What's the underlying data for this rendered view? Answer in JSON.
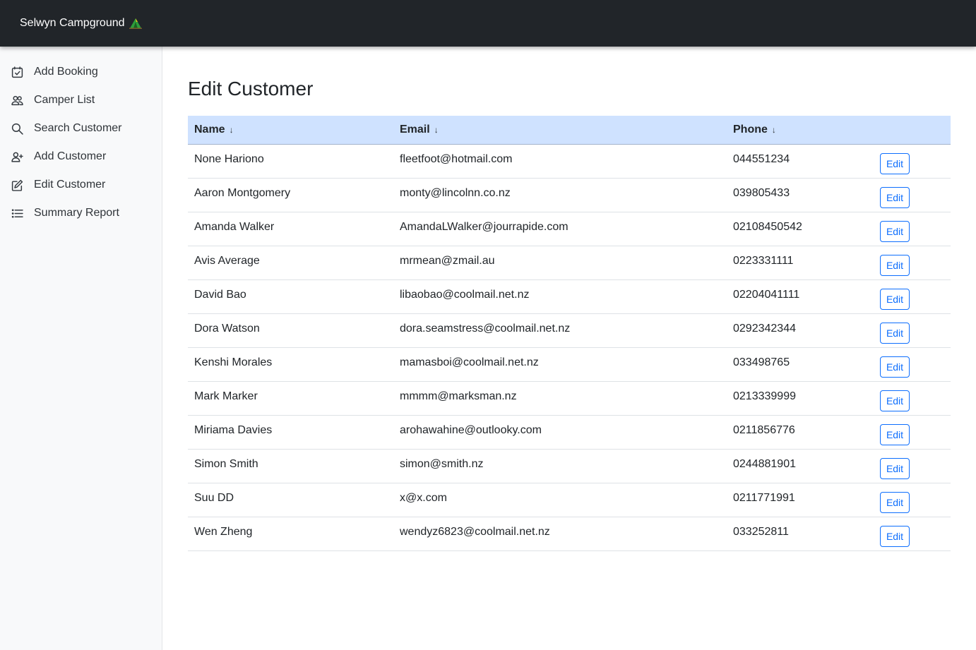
{
  "app": {
    "brand": "Selwyn Campground",
    "brand_icon": "tent-icon"
  },
  "sidebar": {
    "items": [
      {
        "label": "Add Booking",
        "icon": "calendar-check-icon"
      },
      {
        "label": "Camper List",
        "icon": "people-icon"
      },
      {
        "label": "Search Customer",
        "icon": "search-icon"
      },
      {
        "label": "Add Customer",
        "icon": "person-plus-icon"
      },
      {
        "label": "Edit Customer",
        "icon": "pencil-square-icon"
      },
      {
        "label": "Summary Report",
        "icon": "list-icon"
      }
    ]
  },
  "main": {
    "title": "Edit Customer",
    "table": {
      "headers": {
        "name": "Name",
        "email": "Email",
        "phone": "Phone",
        "sort_glyph": "↓"
      },
      "edit_label": "Edit",
      "rows": [
        {
          "name": "None Hariono",
          "email": "fleetfoot@hotmail.com",
          "phone": "044551234"
        },
        {
          "name": "Aaron Montgomery",
          "email": "monty@lincolnn.co.nz",
          "phone": "039805433"
        },
        {
          "name": "Amanda Walker",
          "email": "AmandaLWalker@jourrapide.com",
          "phone": "02108450542"
        },
        {
          "name": "Avis Average",
          "email": "mrmean@zmail.au",
          "phone": "0223331111"
        },
        {
          "name": "David Bao",
          "email": "libaobao@coolmail.net.nz",
          "phone": "02204041111"
        },
        {
          "name": "Dora Watson",
          "email": "dora.seamstress@coolmail.net.nz",
          "phone": "0292342344"
        },
        {
          "name": "Kenshi Morales",
          "email": "mamasboi@coolmail.net.nz",
          "phone": "033498765"
        },
        {
          "name": "Mark Marker",
          "email": "mmmm@marksman.nz",
          "phone": "0213339999"
        },
        {
          "name": "Miriama Davies",
          "email": "arohawahine@outlooky.com",
          "phone": "0211856776"
        },
        {
          "name": "Simon Smith",
          "email": "simon@smith.nz",
          "phone": "0244881901"
        },
        {
          "name": "Suu DD",
          "email": "x@x.com",
          "phone": "0211771991"
        },
        {
          "name": "Wen Zheng",
          "email": "wendyz6823@coolmail.net.nz",
          "phone": "033252811"
        }
      ]
    }
  },
  "colors": {
    "topbar": "#212529",
    "header_row": "#cfe2ff",
    "accent": "#0d6efd",
    "sidebar_bg": "#f8f9fa"
  }
}
